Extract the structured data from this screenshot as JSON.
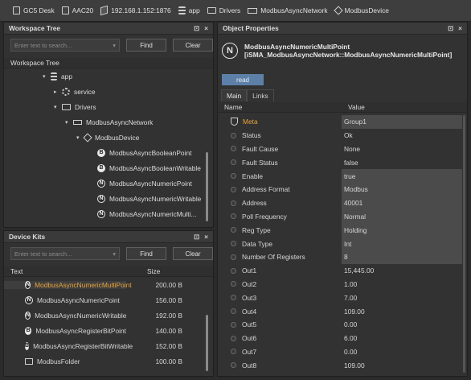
{
  "breadcrumb": [
    {
      "label": "GC5 Desk",
      "icon": "page-icon"
    },
    {
      "label": "AAC20",
      "icon": "page-icon"
    },
    {
      "label": "192.168.1.152:1876",
      "icon": "computer-icon"
    },
    {
      "label": "app",
      "icon": "database-icon"
    },
    {
      "label": "Drivers",
      "icon": "folder-icon"
    },
    {
      "label": "ModbusAsyncNetwork",
      "icon": "network-icon"
    },
    {
      "label": "ModbusDevice",
      "icon": "device-icon"
    }
  ],
  "workspace_tree": {
    "title": "Workspace Tree",
    "search_placeholder": "Enter text to search...",
    "find_label": "Find",
    "clear_label": "Clear",
    "column": "Workspace Tree",
    "items": [
      {
        "label": "app",
        "icon": "database-icon",
        "expanded": true
      },
      {
        "label": "service",
        "icon": "gear-icon",
        "expanded": false
      },
      {
        "label": "Drivers",
        "icon": "folder-icon",
        "expanded": true
      },
      {
        "label": "ModbusAsyncNetwork",
        "icon": "network-icon",
        "expanded": true
      },
      {
        "label": "ModbusDevice",
        "icon": "device-icon",
        "expanded": true
      },
      {
        "label": "ModbusAsyncBooleanPoint",
        "icon": "B"
      },
      {
        "label": "ModbusAsyncBooleanWritable",
        "icon": "B"
      },
      {
        "label": "ModbusAsyncNumericPoint",
        "icon": "N"
      },
      {
        "label": "ModbusAsyncNumericWritable",
        "icon": "N"
      },
      {
        "label": "ModbusAsyncNumericMulti...",
        "icon": "N"
      }
    ]
  },
  "device_kits": {
    "title": "Device Kits",
    "search_placeholder": "Enter text to search...",
    "find_label": "Find",
    "clear_label": "Clear",
    "col_text": "Text",
    "col_size": "Size",
    "items": [
      {
        "name": "ModbusAsyncNumericMultiPoint",
        "size": "200.00 B",
        "icon": "N"
      },
      {
        "name": "ModbusAsyncNumericPoint",
        "size": "156.00 B",
        "icon": "N"
      },
      {
        "name": "ModbusAsyncNumericWritable",
        "size": "192.00 B",
        "icon": "N"
      },
      {
        "name": "ModbusAsyncRegisterBitPoint",
        "size": "140.00 B",
        "icon": "B"
      },
      {
        "name": "ModbusAsyncRegisterBitWritable",
        "size": "152.00 B",
        "icon": "B"
      },
      {
        "name": "ModbusFolder",
        "size": "100.00 B",
        "icon": "folder-icon"
      }
    ]
  },
  "object_properties": {
    "title": "Object Properties",
    "object_name": "ModbusAsyncNumericMultiPoint",
    "object_type": "[iSMA_ModbusAsyncNetwork::ModbusAsyncNumericMultiPoint]",
    "read_label": "read",
    "tabs": [
      "Main",
      "Links"
    ],
    "col_name": "Name",
    "col_value": "Value",
    "rows": [
      {
        "name": "Meta",
        "value": "Group1"
      },
      {
        "name": "Status",
        "value": "Ok"
      },
      {
        "name": "Fault Cause",
        "value": "None"
      },
      {
        "name": "Fault Status",
        "value": "false"
      },
      {
        "name": "Enable",
        "value": "true"
      },
      {
        "name": "Address Format",
        "value": "Modbus"
      },
      {
        "name": "Address",
        "value": "40001"
      },
      {
        "name": "Poll Frequency",
        "value": "Normal"
      },
      {
        "name": "Reg Type",
        "value": "Holding"
      },
      {
        "name": "Data Type",
        "value": "Int"
      },
      {
        "name": "Number Of Registers",
        "value": "8"
      },
      {
        "name": "Out1",
        "value": "15,445.00"
      },
      {
        "name": "Out2",
        "value": "1.00"
      },
      {
        "name": "Out3",
        "value": "7.00"
      },
      {
        "name": "Out4",
        "value": "109.00"
      },
      {
        "name": "Out5",
        "value": "0.00"
      },
      {
        "name": "Out6",
        "value": "6.00"
      },
      {
        "name": "Out7",
        "value": "0.00"
      },
      {
        "name": "Out8",
        "value": "109.00"
      }
    ]
  },
  "colors": {
    "highlight": "#e8a33a",
    "read_button": "#5d80a8"
  }
}
